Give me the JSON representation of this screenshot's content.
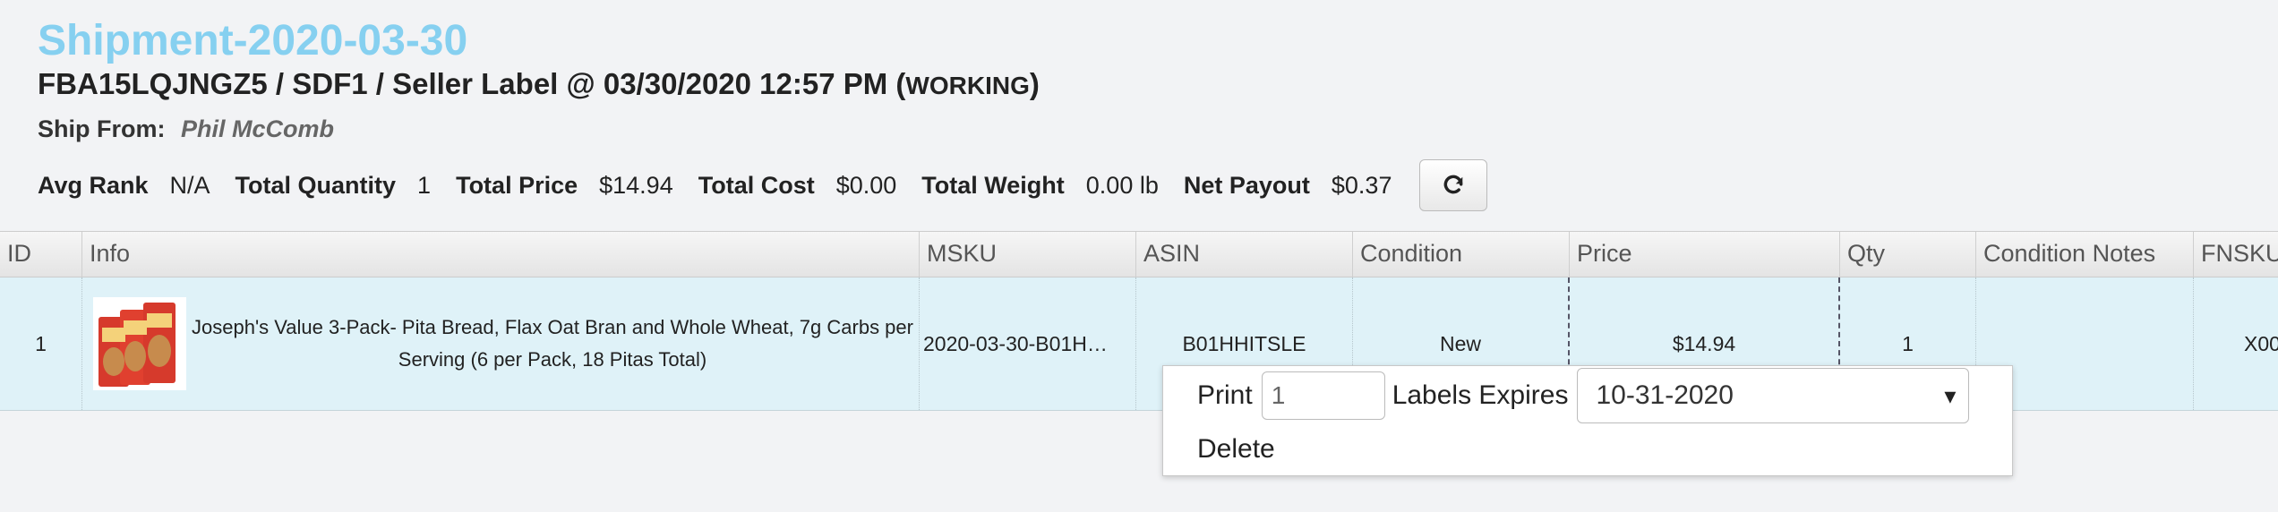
{
  "header": {
    "title": "Shipment-2020-03-30",
    "subtitle_main": "FBA15LQJNGZ5 / SDF1 / Seller Label @ 03/30/2020 12:57 PM (",
    "subtitle_status": "WORKING",
    "subtitle_close": ")",
    "ship_from_label": "Ship From:",
    "ship_from_value": "Phil McComb"
  },
  "stats": [
    {
      "label": "Avg Rank",
      "value": "N/A"
    },
    {
      "label": "Total Quantity",
      "value": "1"
    },
    {
      "label": "Total Price",
      "value": "$14.94"
    },
    {
      "label": "Total Cost",
      "value": "$0.00"
    },
    {
      "label": "Total Weight",
      "value": "0.00 lb"
    },
    {
      "label": "Net Payout",
      "value": "$0.37"
    }
  ],
  "table": {
    "headers": [
      "ID",
      "Info",
      "MSKU",
      "ASIN",
      "Condition",
      "Price",
      "Qty",
      "Condition Notes",
      "FNSKU"
    ],
    "rows": [
      {
        "id": "1",
        "info": "Joseph's Value 3-Pack- Pita Bread, Flax Oat Bran and Whole Wheat, 7g Carbs per Serving (6 per Pack, 18 Pitas Total)",
        "msku": "2020-03-30-B01H…",
        "asin": "B01HHITSLE",
        "condition": "New",
        "price": "$14.94",
        "qty": "1",
        "condition_notes": "",
        "fnsku": "X00"
      }
    ]
  },
  "popup": {
    "print_label": "Print",
    "print_qty": "1",
    "labels_expires_label": "Labels Expires",
    "expires_value": "10-31-2020",
    "delete_label": "Delete"
  },
  "icons": {
    "refresh": "refresh-icon",
    "select_arrow": "▾"
  }
}
